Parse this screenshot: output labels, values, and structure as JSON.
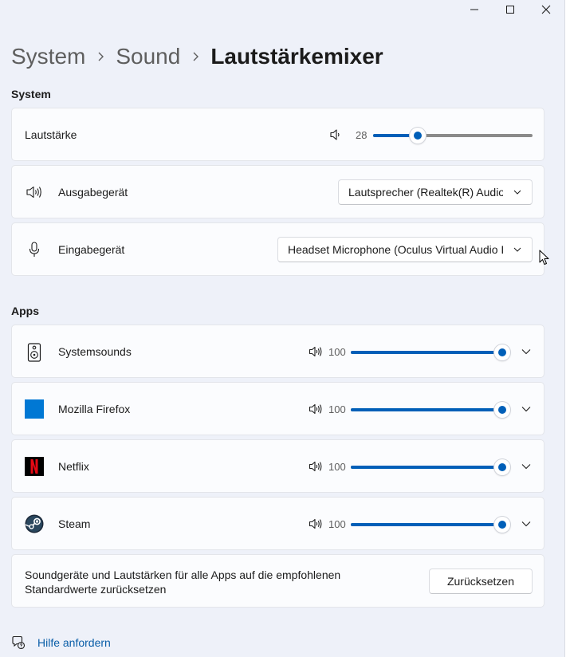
{
  "window": {
    "controls": [
      "minimize-icon",
      "maximize-icon",
      "close-icon"
    ]
  },
  "breadcrumb": {
    "items": [
      "System",
      "Sound",
      "Lautstärkemixer"
    ]
  },
  "system_section": {
    "header": "System",
    "volume": {
      "label": "Lautstärke",
      "value": "28",
      "level_percent": 28,
      "icon": "speaker-low-icon"
    },
    "output": {
      "label": "Ausgabegerät",
      "selected": "Lautsprecher (Realtek(R) Audio)",
      "icon": "speaker-icon"
    },
    "input": {
      "label": "Eingabegerät",
      "selected": "Headset Microphone (Oculus Virtual Audio Device)",
      "icon": "microphone-icon"
    }
  },
  "apps_section": {
    "header": "Apps",
    "apps": [
      {
        "name": "Systemsounds",
        "volume": "100",
        "level_percent": 100,
        "icon": "system-sounds-icon"
      },
      {
        "name": "Mozilla Firefox",
        "volume": "100",
        "level_percent": 100,
        "icon": "firefox-icon"
      },
      {
        "name": "Netflix",
        "volume": "100",
        "level_percent": 100,
        "icon": "netflix-icon"
      },
      {
        "name": "Steam",
        "volume": "100",
        "level_percent": 100,
        "icon": "steam-icon"
      }
    ]
  },
  "reset": {
    "text": "Soundgeräte und Lautstärken für alle Apps auf die empfohlenen Standardwerte zurücksetzen",
    "button": "Zurücksetzen"
  },
  "help": {
    "label": "Hilfe anfordern",
    "icon": "help-icon"
  },
  "colors": {
    "accent": "#005fb8",
    "background": "#eef1f9",
    "card": "#fbfcfe",
    "link": "#0a5ea8",
    "netflix": "#e50914",
    "firefox": "#0078d4"
  }
}
